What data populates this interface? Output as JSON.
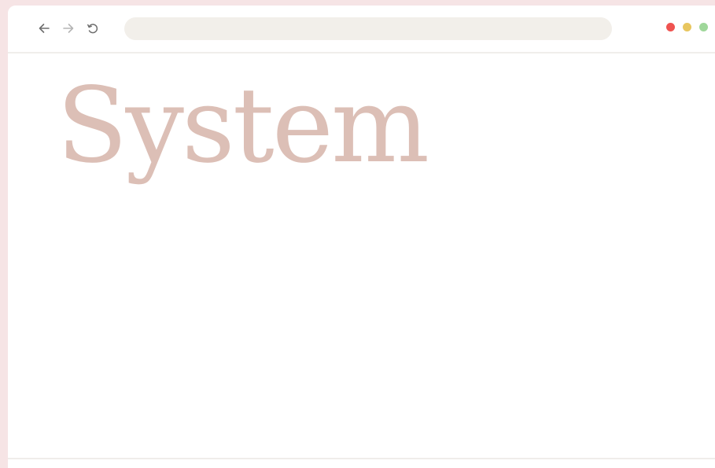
{
  "browser": {
    "address_value": "",
    "address_placeholder": "",
    "nav_icons": [
      "back-arrow-icon",
      "forward-arrow-icon",
      "reload-icon"
    ],
    "window_controls": [
      {
        "name": "close",
        "color": "#ef5350"
      },
      {
        "name": "minimize",
        "color": "#e8c65f"
      },
      {
        "name": "maximize",
        "color": "#9fd79a"
      }
    ]
  },
  "page": {
    "title": "System"
  },
  "colors": {
    "outer_background": "#f6e4e5",
    "title_text": "#dcbfb6",
    "address_bar": "#f2efea",
    "nav_back": "#6e6e6e",
    "nav_forward": "#b5b5b5",
    "nav_reload": "#6e6e6e"
  }
}
